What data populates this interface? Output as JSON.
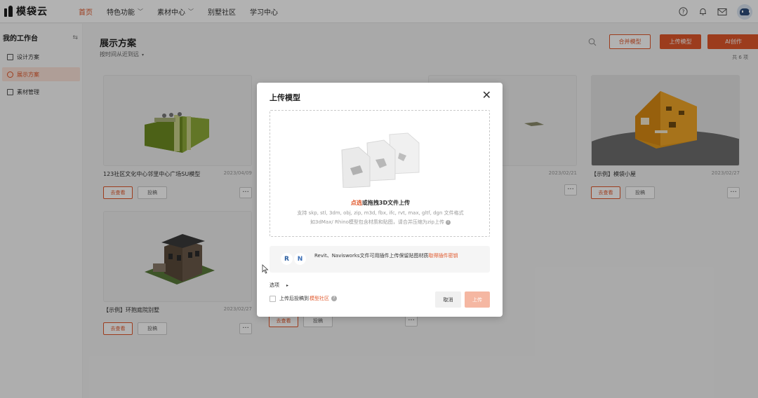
{
  "brand": {
    "name": "模袋云",
    "accent": "#e0572a"
  },
  "nav": [
    {
      "label": "首页",
      "active": true,
      "dropdown": false
    },
    {
      "label": "特色功能",
      "active": false,
      "dropdown": true
    },
    {
      "label": "素材中心",
      "active": false,
      "dropdown": true
    },
    {
      "label": "别墅社区",
      "active": false,
      "dropdown": false
    },
    {
      "label": "学习中心",
      "active": false,
      "dropdown": false
    }
  ],
  "top_icons": [
    "help-icon",
    "bell-icon",
    "mail-icon",
    "avatar"
  ],
  "sidebar": {
    "title": "我的工作台",
    "items": [
      {
        "label": "设计方案",
        "active": false
      },
      {
        "label": "展示方案",
        "active": true
      },
      {
        "label": "素材管理",
        "active": false
      }
    ]
  },
  "main": {
    "title": "展示方案",
    "sort_label": "按时间从近到远",
    "merge_button": "合并模型",
    "upload_button": "上传模型",
    "ai_button": "AI创作",
    "count": "共 6 项"
  },
  "cards": [
    {
      "title": "123社区文化中心邻里中心广场SU模型",
      "date": "2023/04/09",
      "view": "去查看",
      "post": "投稿",
      "more": "···"
    },
    {
      "title": "",
      "date": "2023/02/21",
      "view": "",
      "post": "",
      "more": "···"
    },
    {
      "title": "【示例】模袋小屋",
      "date": "2023/02/27",
      "view": "去查看",
      "post": "投稿",
      "more": "···"
    },
    {
      "title": "【示例】环抱庭院别墅",
      "date": "2023/02/27",
      "view": "去查看",
      "post": "投稿",
      "more": "···"
    },
    {
      "title": "",
      "date": "",
      "view": "去查看",
      "post": "投稿",
      "more": "···"
    }
  ],
  "modal": {
    "title": "上传模型",
    "close": "✕",
    "drop_highlight": "点选",
    "drop_main": "或拖拽3D文件上传",
    "drop_formats": "支持 skp, stl, 3dm, obj, zip, m3d, fbx, ifc, rvt, max, gltf, dgn 文件格式",
    "drop_hint": "如3dMax/ Rhino模型包含材质和贴图，请合并压缩为zip上传",
    "plugin_text": "Revit、Navisworks文件可用插件上传保留贴图材质",
    "plugin_link": "取得插件密钥",
    "plugin_logos": [
      "R",
      "N"
    ],
    "options_label": "选项",
    "checkbox_label": "上传后投稿到",
    "checkbox_link": "模型社区",
    "cancel": "取消",
    "confirm": "上传"
  }
}
